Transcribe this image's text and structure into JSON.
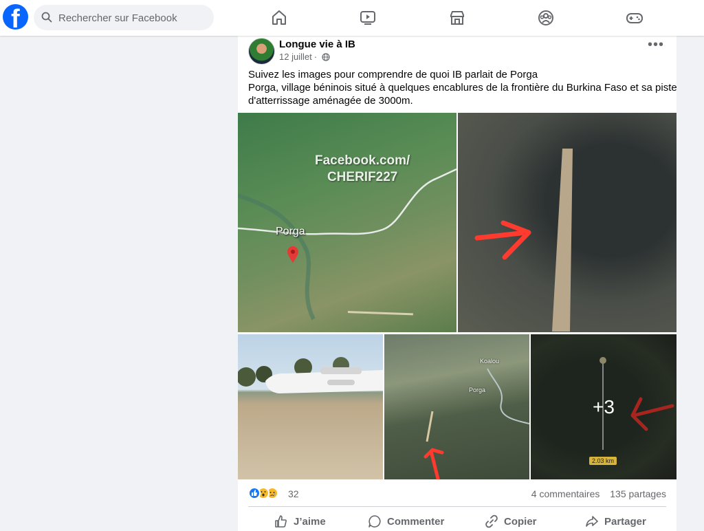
{
  "brand": {
    "logo_letter": "f",
    "color": "#0866ff"
  },
  "search": {
    "placeholder": "Rechercher sur Facebook",
    "icon": "search-icon"
  },
  "nav": [
    {
      "name": "home-icon"
    },
    {
      "name": "video-icon"
    },
    {
      "name": "marketplace-icon"
    },
    {
      "name": "groups-icon"
    },
    {
      "name": "gaming-icon"
    }
  ],
  "post": {
    "author": "Longue vie à IB",
    "date": "12 juillet",
    "privacy_icon": "globe-icon",
    "text_lines": [
      "Suivez les images pour comprendre de quoi IB parlait de Porga",
      "Porga, village béninois situé à quelques encablures de la frontière du Burkina Faso et sa piste",
      "d'atterrissage aménagée de 3000m."
    ],
    "photos": {
      "watermark_line1": "Facebook.com/",
      "watermark_line2": "CHERIF227",
      "map_label": "Porga",
      "small_label_1": "Koalou",
      "small_label_2": "Porga",
      "more_count": "+3",
      "distance": "2.03 km"
    },
    "reactions": {
      "count": "32",
      "icons": [
        "like-icon",
        "wow-icon",
        "sad-icon"
      ]
    },
    "comments": "4 commentaires",
    "shares": "135 partages",
    "actions": {
      "like": "J’aime",
      "comment": "Commenter",
      "copy": "Copier",
      "share": "Partager"
    }
  }
}
